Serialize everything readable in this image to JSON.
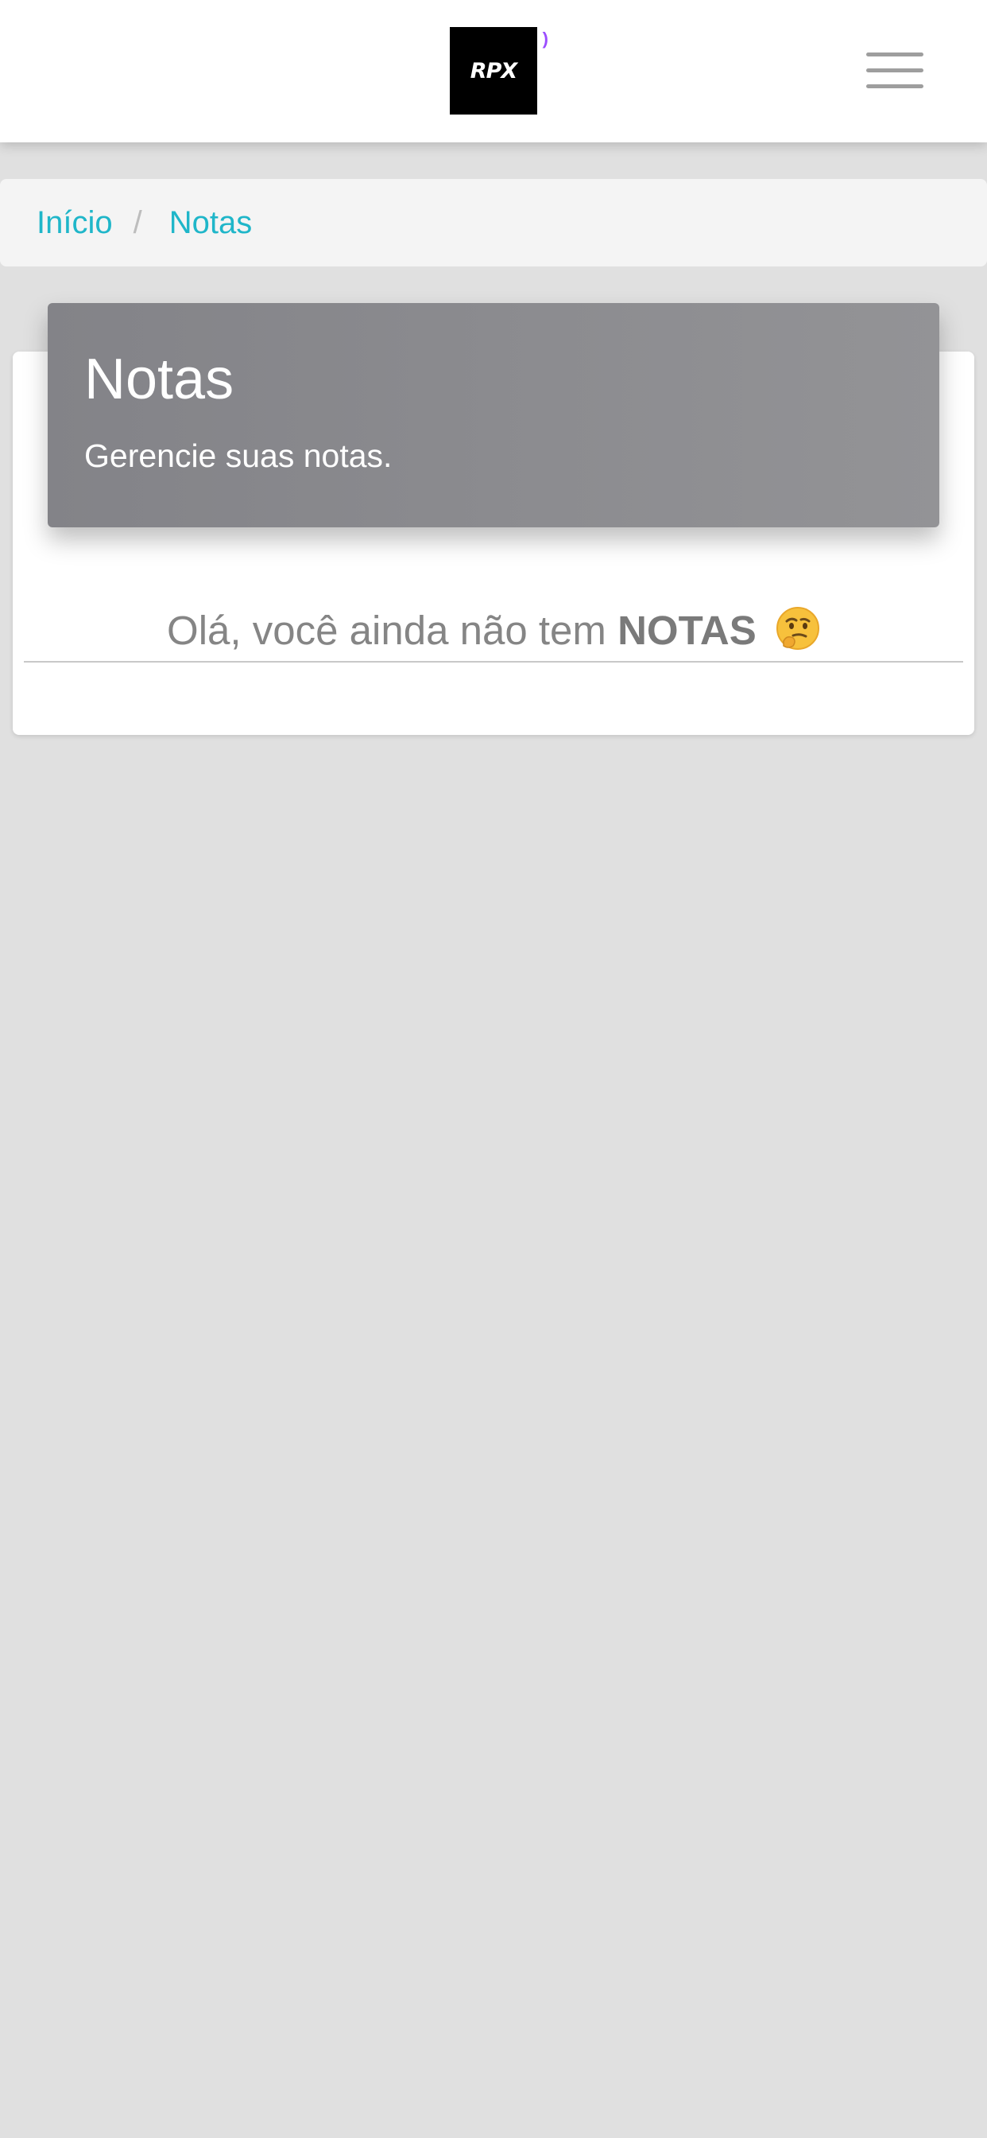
{
  "header": {
    "logo_text": "RPX",
    "menu_icon": "hamburger-menu-icon"
  },
  "breadcrumb": {
    "items": [
      {
        "label": "Início"
      },
      {
        "label": "Notas"
      }
    ],
    "separator": "/"
  },
  "card": {
    "title": "Notas",
    "subtitle": "Gerencie suas notas."
  },
  "empty_state": {
    "text_before": "Olá, você ainda não tem ",
    "emphasis": "NOTAS",
    "emoji_icon": "thinking-face-icon"
  },
  "colors": {
    "link": "#1fb6c9",
    "header_bg": "#8a8a8e",
    "page_bg": "#e0e0e0"
  }
}
